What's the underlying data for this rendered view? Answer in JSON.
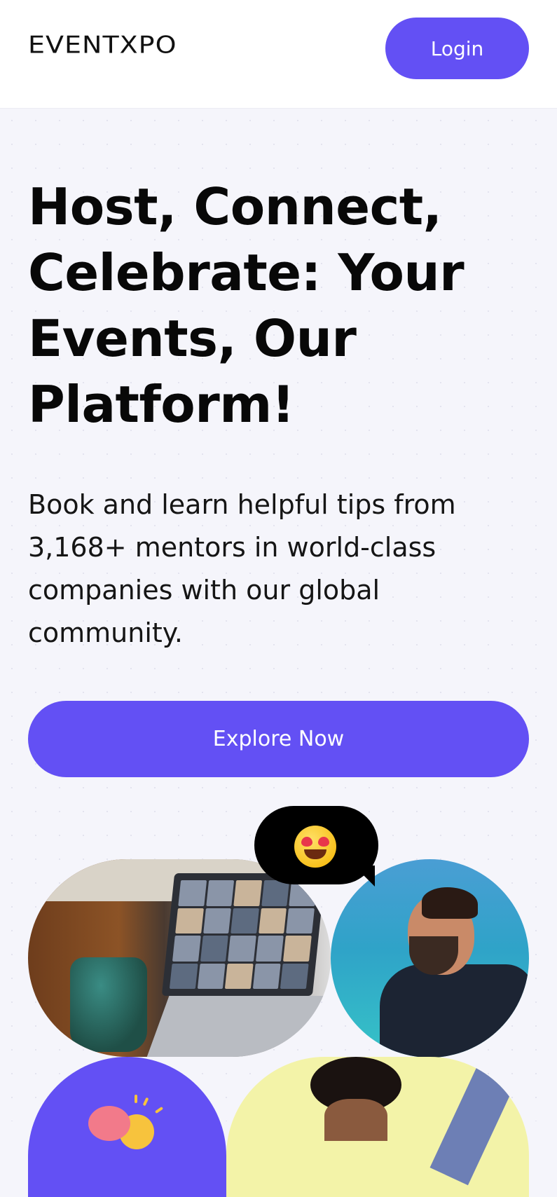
{
  "header": {
    "logo": "EVENTXPO",
    "login_label": "Login"
  },
  "hero": {
    "headline": "Host, Connect, Celebrate: Your Events, Our Platform!",
    "subtext": "Book and learn helpful tips from 3,168+ mentors in world-class companies with our global community.",
    "cta_label": "Explore Now"
  },
  "colors": {
    "brand": "#6350f4",
    "background": "#f5f5fb",
    "header_bg": "#ffffff"
  },
  "icons": {
    "reaction_emoji": "heart-eyes-emoji"
  }
}
